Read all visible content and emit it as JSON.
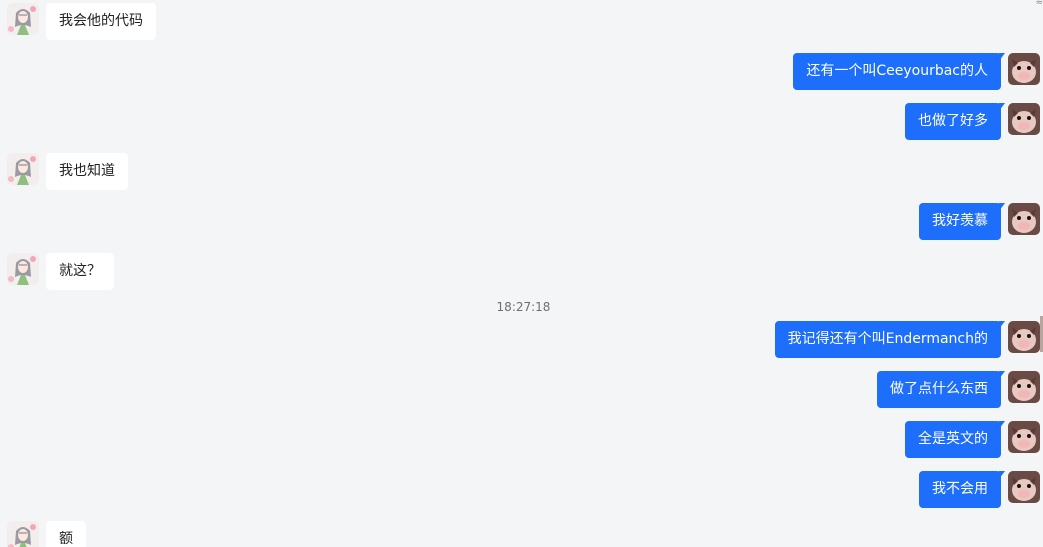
{
  "chat": {
    "timestamp": "18:27:18",
    "corner_glyph": "≈",
    "messages": [
      {
        "side": "in",
        "text": "我会他的代码",
        "avatar": "anime-girl-avatar"
      },
      {
        "side": "out",
        "text": "还有一个叫Ceeyourbac的人",
        "avatar": "cat-avatar"
      },
      {
        "side": "out",
        "text": "也做了好多",
        "avatar": "cat-avatar"
      },
      {
        "side": "in",
        "text": "我也知道",
        "avatar": "anime-girl-avatar"
      },
      {
        "side": "out",
        "text": "我好羡慕",
        "avatar": "cat-avatar"
      },
      {
        "side": "in",
        "text": "就这？",
        "avatar": "anime-girl-avatar"
      },
      {
        "side": "out",
        "text": "我记得还有个叫Endermanch的",
        "avatar": "cat-avatar"
      },
      {
        "side": "out",
        "text": "做了点什么东西",
        "avatar": "cat-avatar"
      },
      {
        "side": "out",
        "text": "全是英文的",
        "avatar": "cat-avatar"
      },
      {
        "side": "out",
        "text": "我不会用",
        "avatar": "cat-avatar"
      },
      {
        "side": "in",
        "text": "额",
        "avatar": "anime-girl-avatar"
      }
    ]
  },
  "colors": {
    "background": "#f4f5f7",
    "outgoing_bubble": "#1e6efc",
    "incoming_bubble": "#ffffff"
  }
}
